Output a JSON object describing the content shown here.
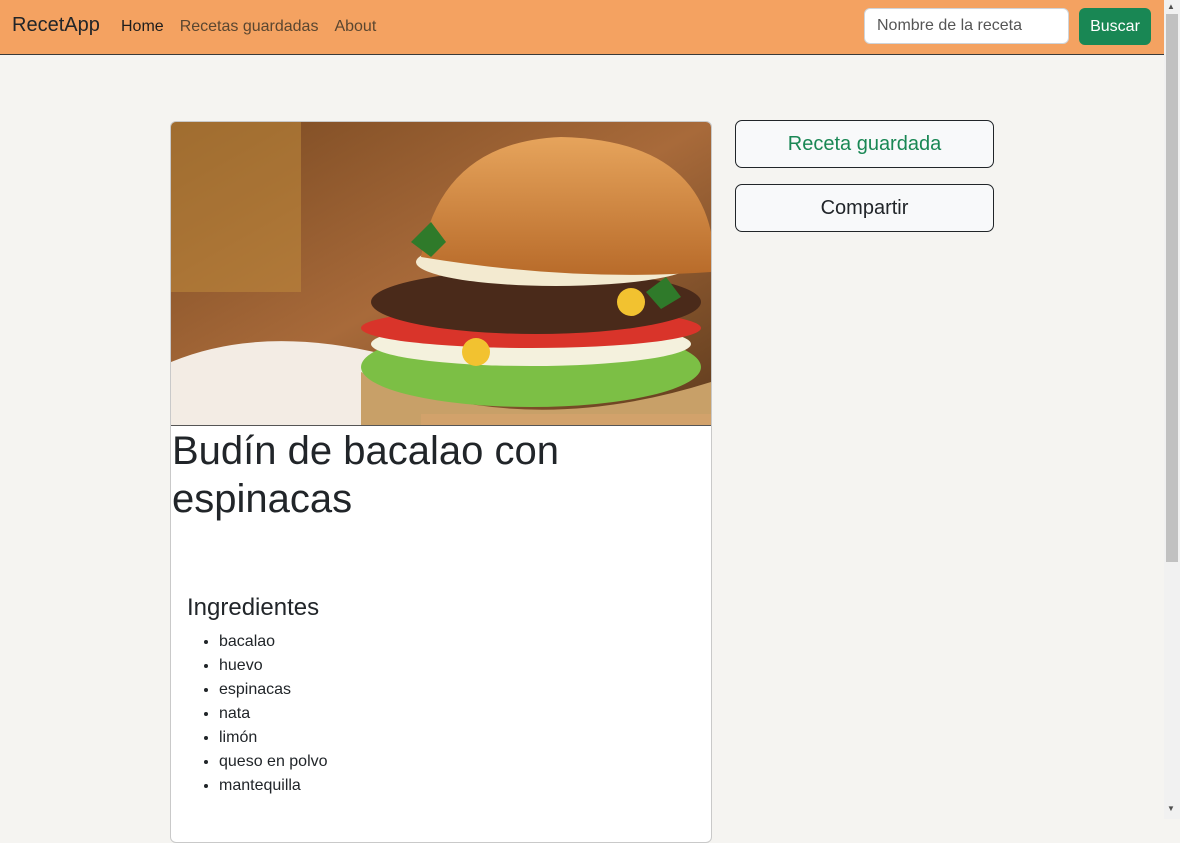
{
  "navbar": {
    "brand": "RecetApp",
    "links": [
      {
        "label": "Home",
        "active": true
      },
      {
        "label": "Recetas guardadas",
        "active": false
      },
      {
        "label": "About",
        "active": false
      }
    ],
    "search": {
      "placeholder": "Nombre de la receta",
      "value": ""
    },
    "search_button": "Buscar",
    "color": "#f4a261"
  },
  "recipe": {
    "title": "Budín de bacalao con espinacas",
    "ingredients_heading": "Ingredientes",
    "ingredients": [
      "bacalao",
      "huevo",
      "espinacas",
      "nata",
      "limón",
      "queso en polvo",
      "mantequilla"
    ]
  },
  "actions": {
    "saved": "Receta guardada",
    "share": "Compartir"
  },
  "colors": {
    "accent": "#198754",
    "background": "#f5f4f1"
  }
}
